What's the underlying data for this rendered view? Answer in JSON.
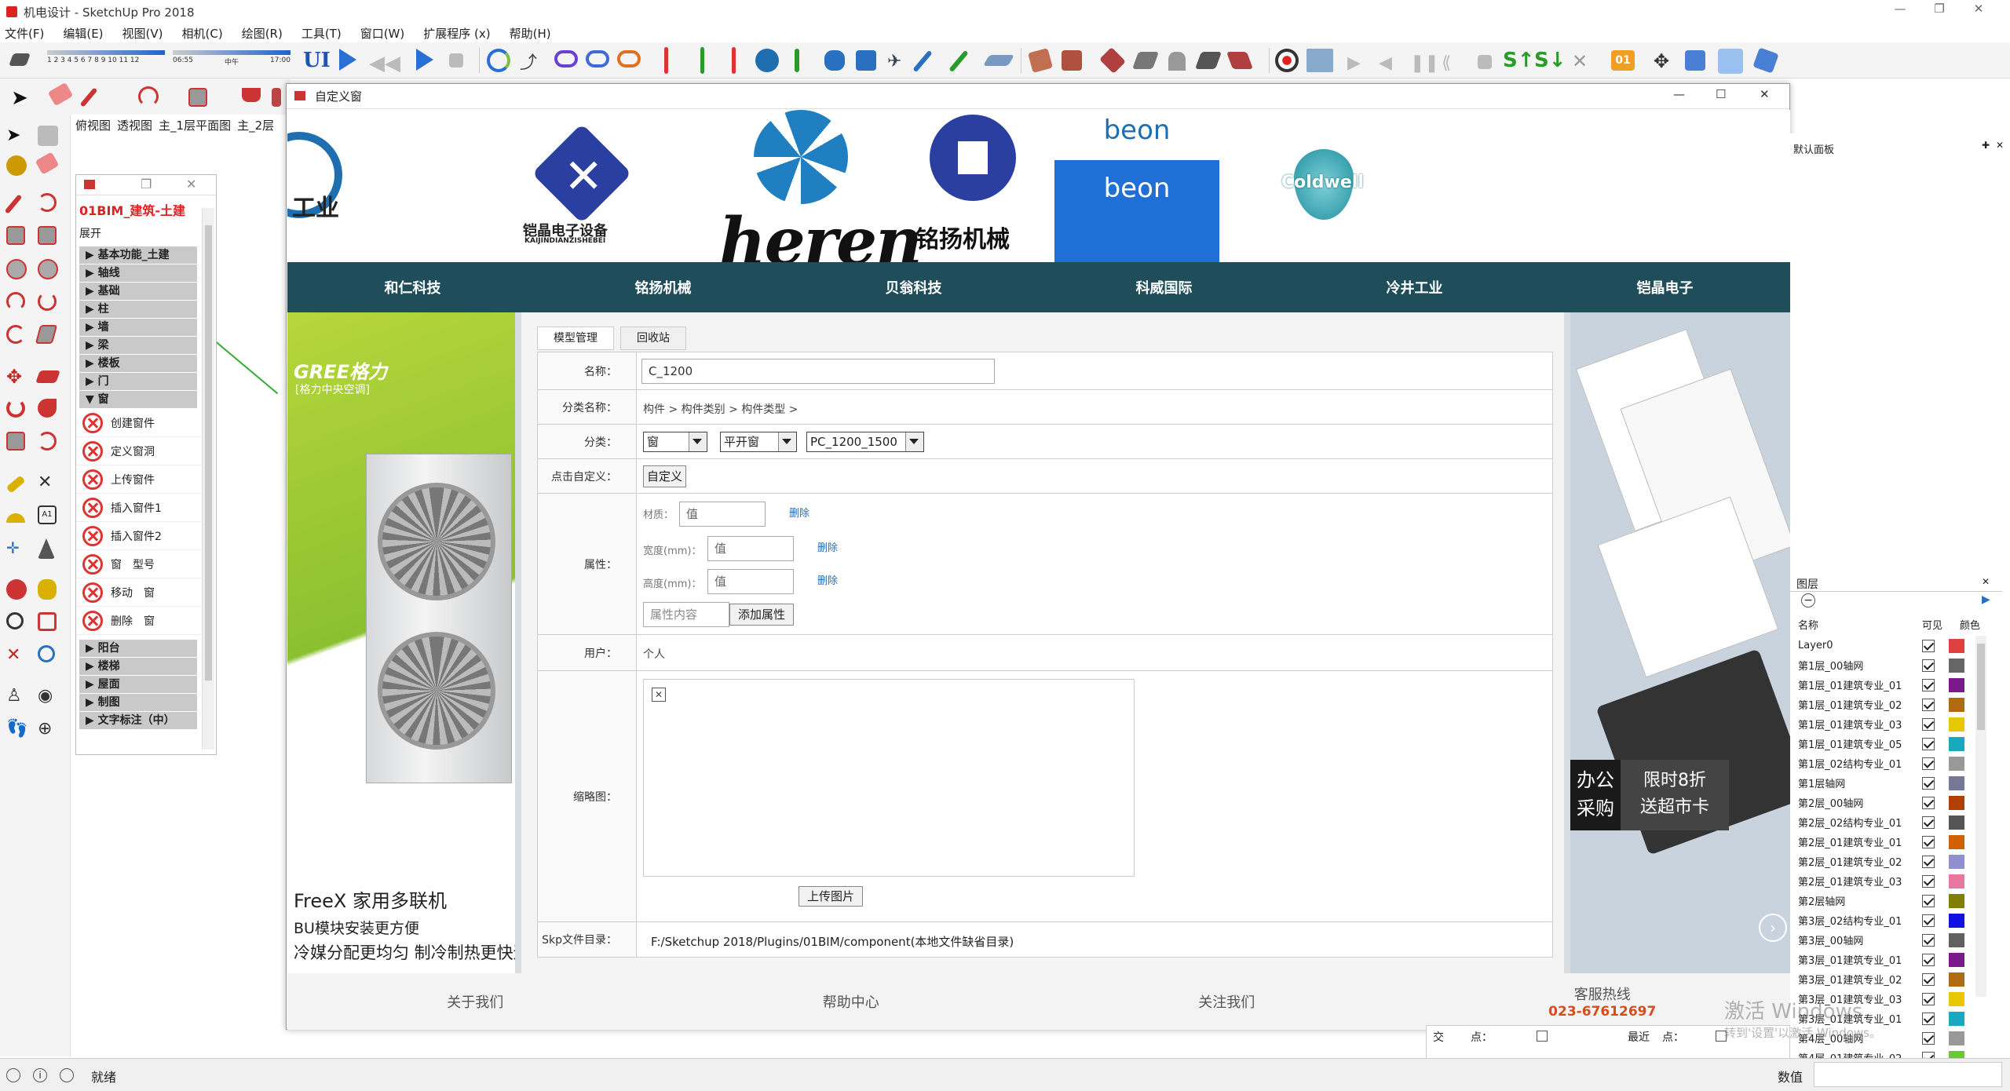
{
  "app": {
    "title": "机电设计 - SketchUp Pro 2018"
  },
  "menu": [
    "文件(F)",
    "编辑(E)",
    "视图(V)",
    "相机(C)",
    "绘图(R)",
    "工具(T)",
    "窗口(W)",
    "扩展程序 (x)",
    "帮助(H)"
  ],
  "scene_tabs": [
    "俯视图",
    "透视图",
    "主_1层平面图",
    "主_2层"
  ],
  "plugin": {
    "title": "01BIM_建筑-土建",
    "expand": "展开",
    "categories_top": [
      "基本功能_土建",
      "轴线",
      "基础",
      "柱",
      "墙",
      "梁",
      "楼板",
      "门",
      "窗"
    ],
    "window_items": [
      "创建窗件",
      "定义窗洞",
      "上传窗件",
      "插入窗件1",
      "插入窗件2",
      "窗　型号",
      "移动　窗",
      "删除　窗"
    ],
    "categories_bottom": [
      "阳台",
      "楼梯",
      "屋面",
      "制图",
      "文字标注（中）"
    ]
  },
  "dialog": {
    "title": "自定义窗",
    "banner_logos": [
      "工业",
      "铠晶电子设备",
      "KAIJINDIANZISHEBEI",
      "heren",
      "铭扬机械",
      "beon",
      "beon",
      "Coldwell"
    ],
    "nav": [
      "和仁科技",
      "铭扬机械",
      "贝翁科技",
      "科威国际",
      "冷井工业",
      "铠晶电子"
    ],
    "tabs": [
      "模型管理",
      "回收站"
    ],
    "form": {
      "name_label": "名称：",
      "name_value": "C_1200",
      "category_label": "分类名称：",
      "category_value": "构件 > 构件类别 > 构件类型 >",
      "class_label": "分类：",
      "class_select1": "窗",
      "class_select2": "平开窗",
      "class_select3": "PC_1200_1500",
      "custom_label": "点击自定义：",
      "custom_button": "自定义",
      "attr_label": "属性：",
      "attrs": [
        {
          "name": "材质：",
          "placeholder": "值",
          "delete": "删除"
        },
        {
          "name": "宽度(mm)：",
          "placeholder": "值",
          "delete": "删除"
        },
        {
          "name": "高度(mm)：",
          "placeholder": "值",
          "delete": "删除"
        }
      ],
      "attr_content_placeholder": "属性内容",
      "add_attr_button": "添加属性",
      "user_label": "用户：",
      "user_value": "个人",
      "thumb_label": "缩略图：",
      "upload_button": "上传图片",
      "skp_label": "Skp文件目录：",
      "skp_value": "F:/Sketchup 2018/Plugins/01BIM/component(本地文件缺省目录)"
    },
    "left_ad": {
      "brand": "GREE格力",
      "sub": "[格力中央空调]",
      "product": "FreeX 家用多联机",
      "line1": "BU模块安装更方便",
      "line2": "冷媒分配更均匀  制冷制热更快速"
    },
    "right_ad": {
      "tag1": "办公\n采购",
      "tag2": "限时8折\n送超市卡"
    },
    "footer": {
      "about": "关于我们",
      "help": "帮助中心",
      "follow": "关注我们",
      "hotline_label": "客服热线",
      "hotline": "023-67612697"
    }
  },
  "layers_panel": {
    "panel_title": "图层",
    "tray_title": "默认面板",
    "col_name": "名称",
    "col_visible": "可见",
    "col_color": "颜色",
    "layers": [
      {
        "name": "Layer0",
        "color": "#e04040"
      },
      {
        "name": "第1层_00轴网",
        "color": "#666666"
      },
      {
        "name": "第1层_01建筑专业_01",
        "color": "#7a1a8a"
      },
      {
        "name": "第1层_01建筑专业_02",
        "color": "#b06a10"
      },
      {
        "name": "第1层_01建筑专业_03",
        "color": "#e8c800"
      },
      {
        "name": "第1层_01建筑专业_05",
        "color": "#18a8c0"
      },
      {
        "name": "第1层_02结构专业_01",
        "color": "#999999"
      },
      {
        "name": "第1层轴网",
        "color": "#777799"
      },
      {
        "name": "第2层_00轴网",
        "color": "#b04000"
      },
      {
        "name": "第2层_02结构专业_01",
        "color": "#555555"
      },
      {
        "name": "第2层_01建筑专业_01",
        "color": "#d06000"
      },
      {
        "name": "第2层_01建筑专业_02",
        "color": "#9090d0"
      },
      {
        "name": "第2层_01建筑专业_03",
        "color": "#e878a0"
      },
      {
        "name": "第2层轴网",
        "color": "#808000"
      },
      {
        "name": "第3层_02结构专业_01",
        "color": "#1010e0"
      },
      {
        "name": "第3层_00轴网",
        "color": "#606060"
      },
      {
        "name": "第3层_01建筑专业_01",
        "color": "#7a1a8a"
      },
      {
        "name": "第3层_01建筑专业_02",
        "color": "#b06a10"
      },
      {
        "name": "第3层_01建筑专业_03",
        "color": "#e8c800"
      },
      {
        "name": "第3层_01建筑专业_01",
        "color": "#18a8c0"
      },
      {
        "name": "第4层_00轴网",
        "color": "#999999"
      },
      {
        "name": "第4层_01建筑专业_02",
        "color": "#66cc33"
      }
    ],
    "extra_labels": {
      "cross": "交",
      "point": "点：",
      "nearest": "最近",
      "point2": "点："
    }
  },
  "watermark": {
    "line1": "激活 Windows",
    "line2": "转到'设置'以激活 Windows。"
  },
  "status": {
    "text": "就绪",
    "measure_label": "数值"
  },
  "toolbar_scale_left": "06:55",
  "toolbar_scale_mid": "中午",
  "toolbar_scale_right": "17:00",
  "toolbar_months": "1 2 3 4 5 6 7 8 9 10 11 12"
}
